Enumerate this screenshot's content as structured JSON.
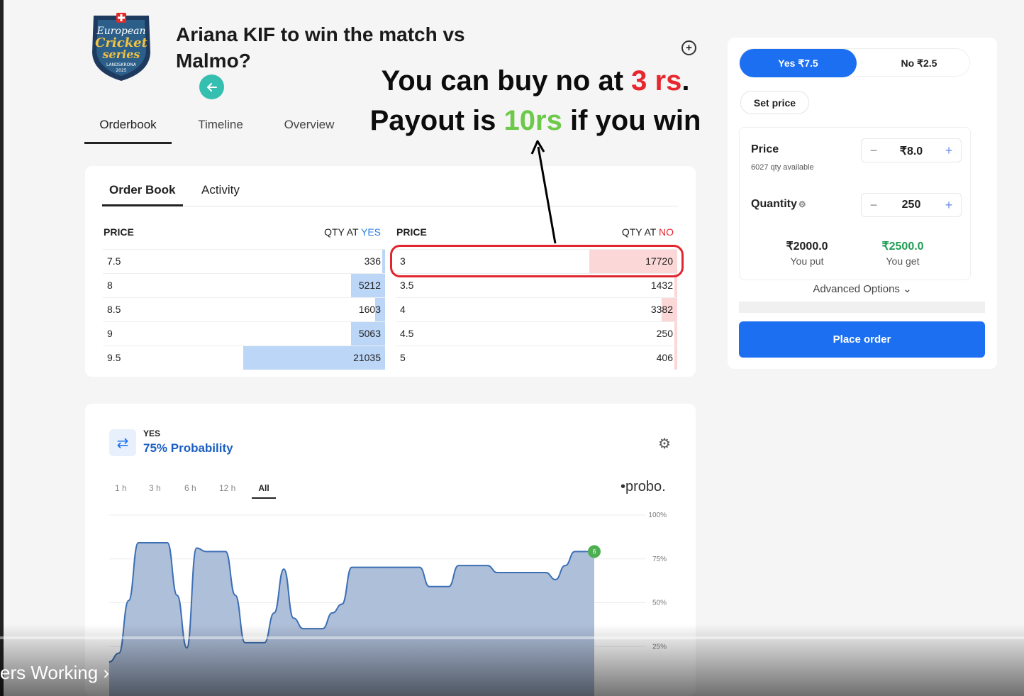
{
  "market": {
    "question": "Ariana KIF to win the match vs Malmo?"
  },
  "logo": {
    "line1": "European",
    "line2": "Cricket",
    "line3": "series",
    "line4": "LANDSKRONA",
    "line5": "2025"
  },
  "nav_tabs": [
    "Orderbook",
    "Timeline",
    "Overview"
  ],
  "annotation": {
    "line1_prefix": "You can buy no at ",
    "line1_highlight": "3 rs",
    "line1_suffix": ".",
    "line2_prefix": "Payout is ",
    "line2_highlight": "10rs",
    "line2_suffix": " if you win"
  },
  "orderbook": {
    "tabs": [
      "Order Book",
      "Activity"
    ],
    "price_header": "PRICE",
    "qty_yes_prefix": "QTY AT ",
    "qty_yes_word": "YES",
    "qty_no_prefix": "QTY AT ",
    "qty_no_word": "NO",
    "yes_rows": [
      {
        "price": "7.5",
        "qty": "336",
        "fill": 0.02
      },
      {
        "price": "8",
        "qty": "5212",
        "fill": 0.24
      },
      {
        "price": "8.5",
        "qty": "1603",
        "fill": 0.07
      },
      {
        "price": "9",
        "qty": "5063",
        "fill": 0.24
      },
      {
        "price": "9.5",
        "qty": "21035",
        "fill": 1.0
      }
    ],
    "no_rows": [
      {
        "price": "3",
        "qty": "17720",
        "fill": 0.62
      },
      {
        "price": "3.5",
        "qty": "1432",
        "fill": 0.02
      },
      {
        "price": "4",
        "qty": "3382",
        "fill": 0.11
      },
      {
        "price": "4.5",
        "qty": "250",
        "fill": 0.01
      },
      {
        "price": "5",
        "qty": "406",
        "fill": 0.01
      }
    ]
  },
  "order_panel": {
    "yes_label": "Yes ₹7.5",
    "no_label": "No ₹2.5",
    "set_price": "Set price",
    "price_label": "Price",
    "qty_available": "6027 qty available",
    "price_value": "₹8.0",
    "quantity_label": "Quantity",
    "quantity_value": "250",
    "you_put_value": "₹2000.0",
    "you_put_label": "You put",
    "you_get_value": "₹2500.0",
    "you_get_label": "You get",
    "advanced": "Advanced Options",
    "place_order": "Place order",
    "colors": {
      "accent": "#1b6ff0",
      "get_green": "#1f9d55"
    }
  },
  "probability": {
    "side": "YES",
    "value": "75% Probability",
    "ranges": [
      "1 h",
      "3 h",
      "6 h",
      "12 h",
      "All"
    ],
    "active_range": "All",
    "brand": "•probo.",
    "end_marker": "6"
  },
  "chart_data": {
    "type": "area",
    "y_ticks": [
      "100%",
      "75%",
      "50%",
      "25%"
    ],
    "ylim": [
      0,
      100
    ],
    "x": [
      0,
      1,
      2,
      3,
      4,
      5,
      6,
      7,
      8,
      9,
      10,
      11,
      12,
      13,
      14,
      15,
      16,
      17,
      18,
      19,
      20,
      21,
      22,
      23,
      24,
      25,
      26,
      27,
      28,
      29,
      30,
      31,
      32,
      33,
      34,
      35,
      36,
      37,
      38,
      39,
      40,
      41,
      42,
      43,
      44,
      45,
      46,
      47,
      48,
      49,
      50
    ],
    "values": [
      17,
      22,
      52,
      85,
      85,
      85,
      85,
      55,
      25,
      82,
      80,
      80,
      80,
      55,
      28,
      28,
      28,
      45,
      70,
      42,
      36,
      36,
      36,
      45,
      50,
      71,
      71,
      71,
      71,
      71,
      71,
      71,
      71,
      60,
      60,
      60,
      72,
      72,
      72,
      72,
      68,
      68,
      68,
      68,
      68,
      68,
      64,
      72,
      80,
      80,
      80
    ],
    "color": "#3c6fb4",
    "fill": "#aebfd9"
  },
  "video_overlay": {
    "chapter_text": "ers Working"
  }
}
